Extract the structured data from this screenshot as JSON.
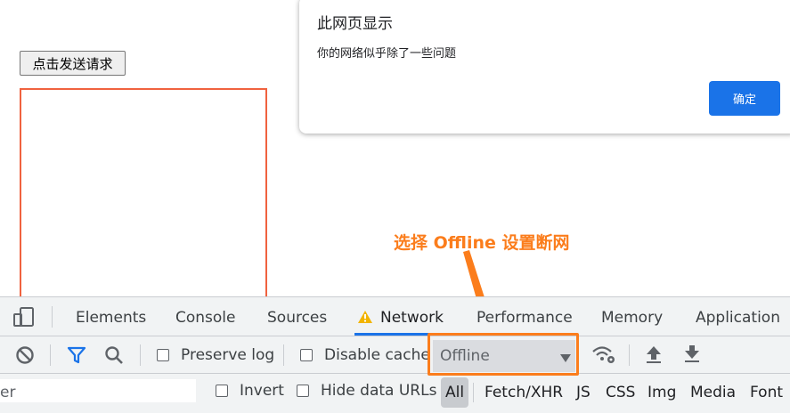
{
  "page": {
    "send_button": "点击发送请求"
  },
  "dialog": {
    "title": "此网页显示",
    "message": "你的网络似乎除了一些问题",
    "ok_label": "确定"
  },
  "annotation": {
    "text": "选择 Offline 设置断网",
    "color": "#fb7d1c"
  },
  "devtools": {
    "tabs": [
      {
        "label": "Elements"
      },
      {
        "label": "Console"
      },
      {
        "label": "Sources"
      },
      {
        "label": "Network",
        "active": true,
        "warning": true
      },
      {
        "label": "Performance"
      },
      {
        "label": "Memory"
      },
      {
        "label": "Application"
      }
    ],
    "toolbar": {
      "preserve_log": "Preserve log",
      "disable_cache": "Disable cache",
      "throttling_value": "Offline"
    },
    "filter": {
      "placeholder_visible": "er",
      "invert": "Invert",
      "hide_data_urls": "Hide data URLs",
      "types": [
        "All",
        "Fetch/XHR",
        "JS",
        "CSS",
        "Img",
        "Media",
        "Font"
      ]
    },
    "accent_color": "#1a73e8"
  }
}
